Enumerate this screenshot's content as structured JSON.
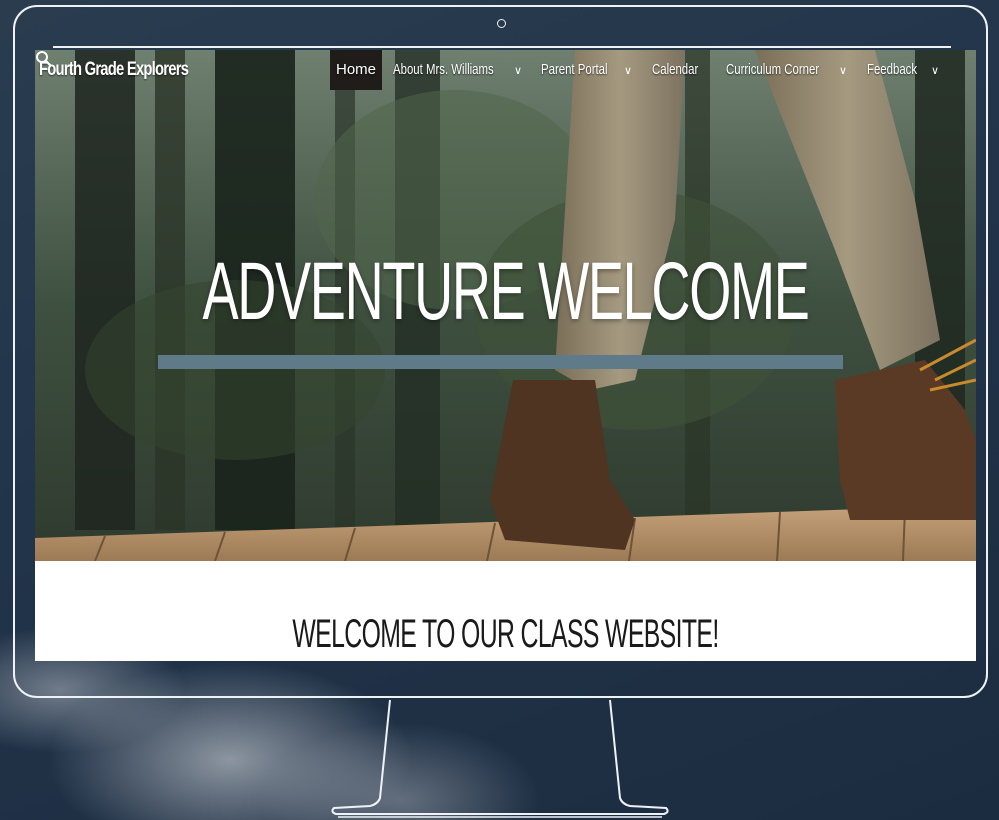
{
  "site": {
    "title": "Fourth Grade Explorers"
  },
  "nav": {
    "items": [
      {
        "label": "Home",
        "active": true,
        "has_dropdown": false
      },
      {
        "label": "About Mrs. Williams",
        "has_dropdown": true
      },
      {
        "label": "Parent Portal",
        "has_dropdown": true
      },
      {
        "label": "Calendar",
        "has_dropdown": false
      },
      {
        "label": "Curriculum Corner",
        "has_dropdown": true
      },
      {
        "label": "Feedback",
        "has_dropdown": true
      }
    ],
    "search_icon": "search-icon",
    "dropdown_icon": "chevron-down-icon"
  },
  "hero": {
    "title": "ADVENTURE WELCOME",
    "accent_color": "#5f7a89"
  },
  "main": {
    "welcome_heading": "WELCOME TO OUR CLASS WEBSITE!"
  },
  "colors": {
    "active_nav_bg": "#1f1c1a",
    "text_light": "#ffffff",
    "heading_dark": "#1a1a1a"
  }
}
